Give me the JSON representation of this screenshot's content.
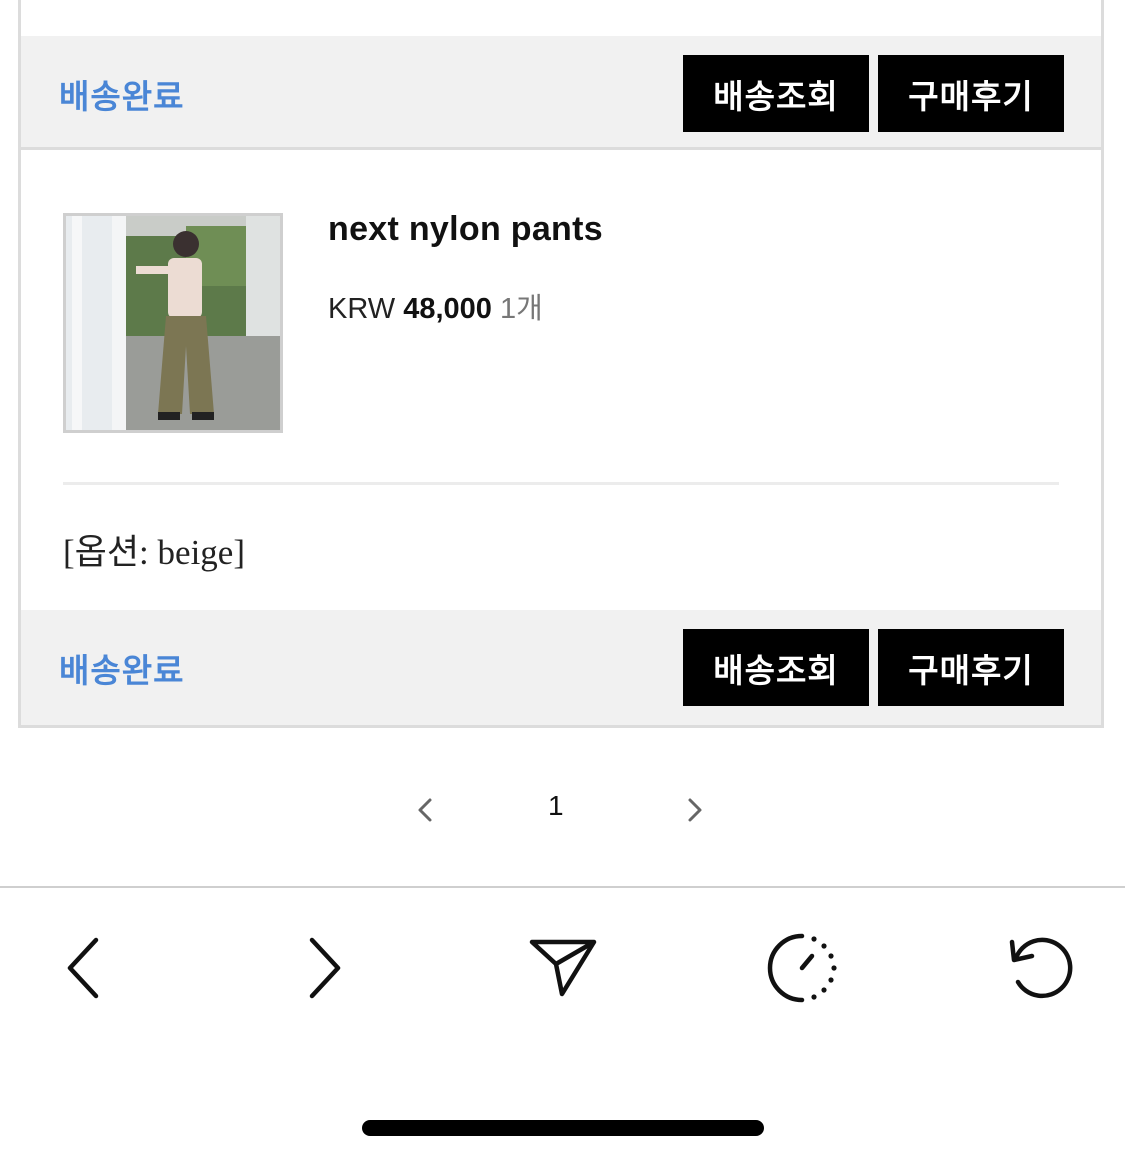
{
  "order": {
    "status_top": "배송완료",
    "status_bottom": "배송완료",
    "track_button": "배송조회",
    "review_button": "구매후기",
    "item": {
      "name": "next nylon pants",
      "currency": "KRW",
      "price": "48,000",
      "quantity": "1개",
      "option": "[옵션: beige]"
    }
  },
  "pagination": {
    "current_page": "1"
  },
  "browser_toolbar": {
    "icons": [
      "back-icon",
      "forward-icon",
      "share-icon",
      "history-icon",
      "reload-icon"
    ]
  },
  "colors": {
    "status": "#4a86d6",
    "button_bg": "#000000",
    "bar_bg": "#f1f1f1"
  }
}
